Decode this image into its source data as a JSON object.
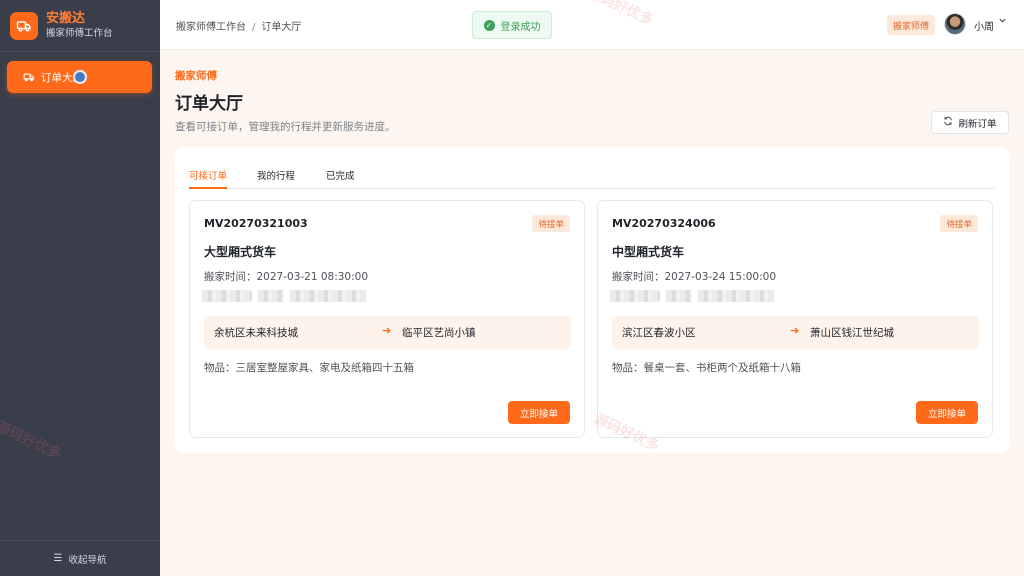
{
  "brand": {
    "title": "安搬达",
    "subtitle": "搬家师傅工作台"
  },
  "sidebar": {
    "items": [
      {
        "label": "订单大厅",
        "icon": "truck-icon",
        "active": true
      }
    ],
    "collapse_label": "收起导航"
  },
  "header": {
    "breadcrumb": [
      "搬家师傅工作台",
      "订单大厅"
    ],
    "toast": "登录成功",
    "role_tag": "搬家师傅",
    "user_name": "小周"
  },
  "page": {
    "eyebrow": "搬家师傅",
    "title": "订单大厅",
    "description": "查看可接订单，管理我的行程并更新服务进度。",
    "refresh_label": "刷新订单"
  },
  "tabs": [
    {
      "label": "可接订单",
      "active": true
    },
    {
      "label": "我的行程",
      "active": false
    },
    {
      "label": "已完成",
      "active": false
    }
  ],
  "orders": [
    {
      "order_no": "MV20270321003",
      "status": "待接单",
      "vehicle": "大型厢式货车",
      "move_time": "搬家时间：2027-03-21 08:30:00",
      "from": "余杭区未来科技城",
      "to": "临平区艺尚小镇",
      "goods": "物品：三居室整屋家具、家电及纸箱四十五箱",
      "action_label": "立即接单"
    },
    {
      "order_no": "MV20270324006",
      "status": "待接单",
      "vehicle": "中型厢式货车",
      "move_time": "搬家时间：2027-03-24 15:00:00",
      "from": "滨江区春波小区",
      "to": "萧山区钱江世纪城",
      "goods": "物品：餐桌一套、书柜两个及纸箱十八箱",
      "action_label": "立即接单"
    }
  ],
  "watermark": "源码好优多",
  "colors": {
    "accent": "#ff6a1a",
    "sidebar_bg": "#3a3d4a",
    "success": "#3ea05a",
    "page_bg": "#fdf6f0"
  }
}
